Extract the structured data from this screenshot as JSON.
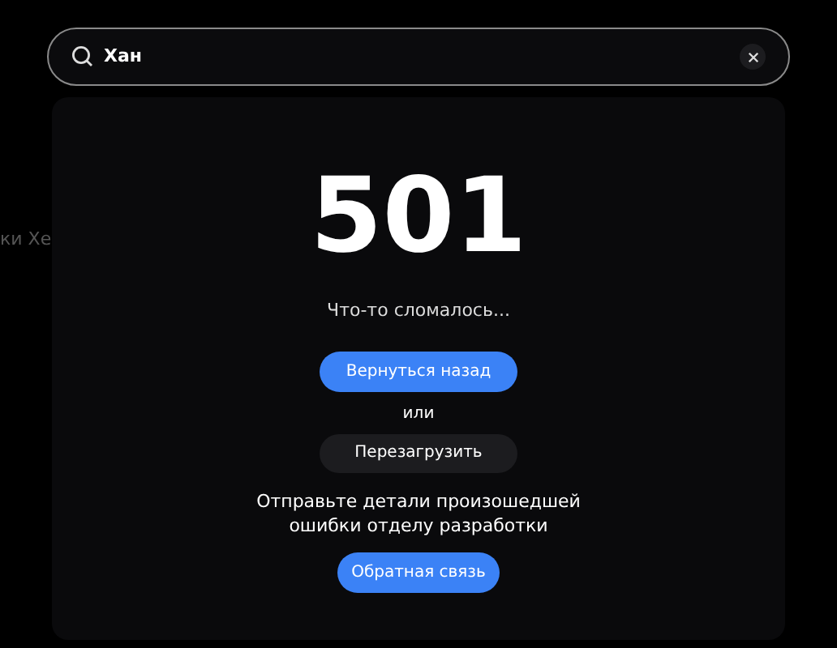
{
  "background_text": "ки Хе",
  "search": {
    "value": "Хан"
  },
  "error": {
    "code": "501",
    "message": "Что-то сломалось...",
    "back_button": "Вернуться назад",
    "separator": "или",
    "reload_button": "Перезагрузить",
    "report_text": "Отправьте детали произошедшей ошибки отделу разработки",
    "feedback_button": "Обратная связь"
  }
}
